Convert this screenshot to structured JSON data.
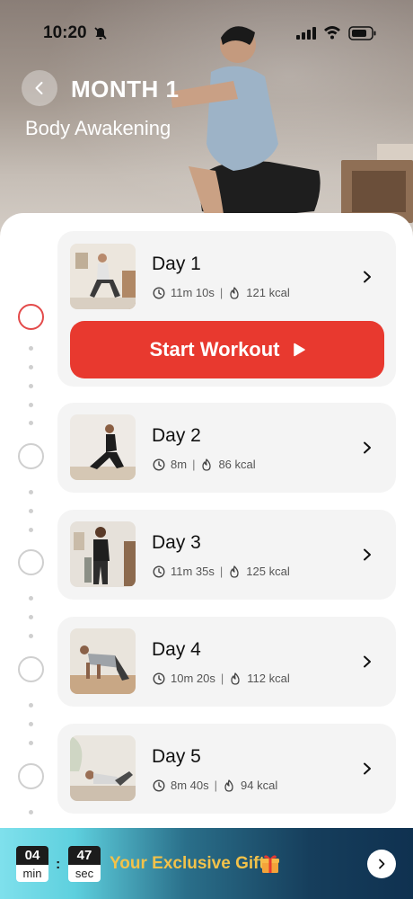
{
  "status_bar": {
    "time": "10:20"
  },
  "header": {
    "title": "MONTH 1",
    "subtitle": "Body Awakening"
  },
  "colors": {
    "accent": "#e8392f",
    "active_ring": "#e34a4a",
    "gift_text": "#f2c24a"
  },
  "start_button": {
    "label": "Start Workout"
  },
  "days": [
    {
      "label": "Day 1",
      "duration": "11m 10s",
      "calories": "121 kcal",
      "active": true
    },
    {
      "label": "Day 2",
      "duration": "8m",
      "calories": "86 kcal",
      "active": false
    },
    {
      "label": "Day 3",
      "duration": "11m 35s",
      "calories": "125 kcal",
      "active": false
    },
    {
      "label": "Day 4",
      "duration": "10m 20s",
      "calories": "112 kcal",
      "active": false
    },
    {
      "label": "Day 5",
      "duration": "8m 40s",
      "calories": "94 kcal",
      "active": false
    }
  ],
  "separator": "|",
  "banner": {
    "minutes": "04",
    "minutes_unit": "min",
    "seconds": "47",
    "seconds_unit": "sec",
    "colon": ":",
    "text": "Your Exclusive Gift"
  },
  "icons": {
    "back": "chevron-left-icon",
    "clock": "clock-icon",
    "flame": "flame-icon",
    "chevron": "chevron-right-icon",
    "play": "play-icon",
    "gift": "gift-icon"
  }
}
